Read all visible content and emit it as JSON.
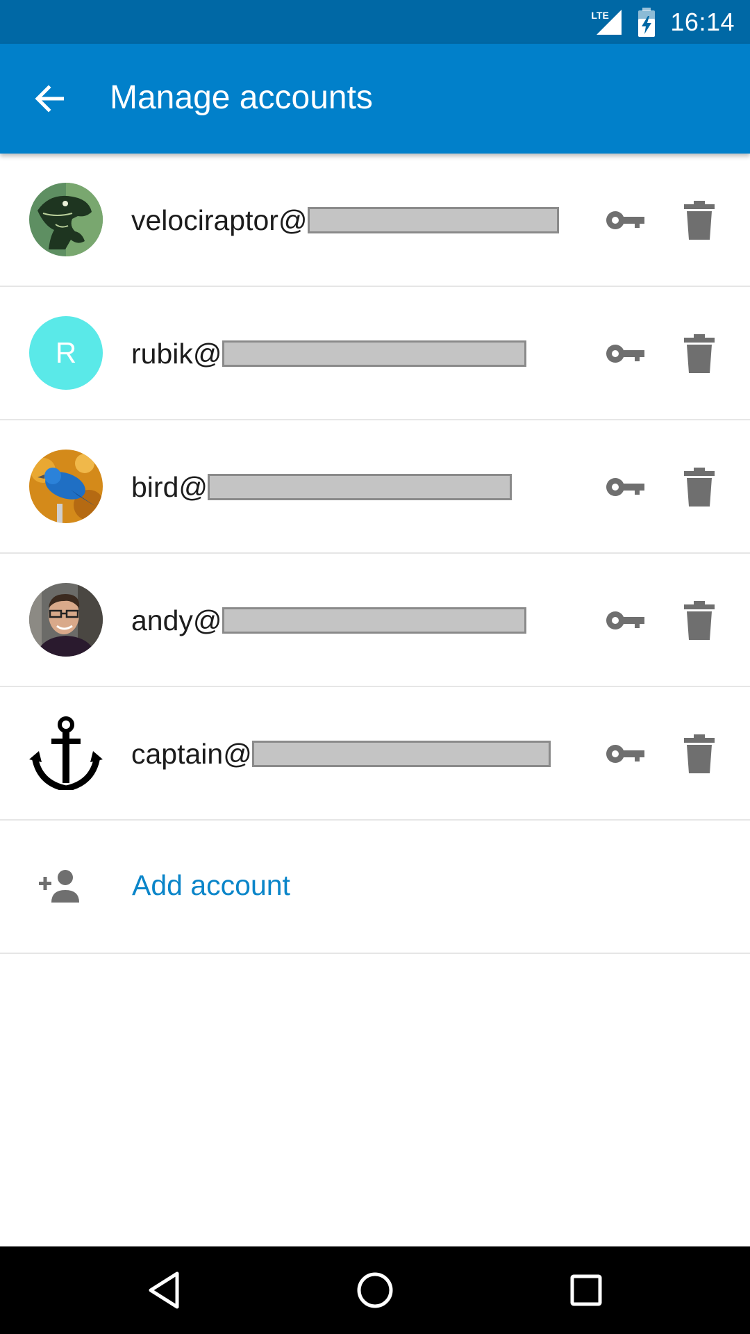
{
  "status_bar": {
    "network": "LTE",
    "time": "16:14"
  },
  "app_bar": {
    "title": "Manage accounts",
    "back_icon": "arrow-back-icon"
  },
  "accounts": [
    {
      "email_prefix": "velociraptor@",
      "avatar": "raptor-image"
    },
    {
      "email_prefix": "rubik@",
      "avatar_letter": "R",
      "avatar_color": "#5ae9e8"
    },
    {
      "email_prefix": "bird@",
      "avatar": "bird-image"
    },
    {
      "email_prefix": "andy@",
      "avatar": "person-photo"
    },
    {
      "email_prefix": "captain@",
      "avatar": "anchor-icon"
    }
  ],
  "row_icons": {
    "key": "key-icon",
    "delete": "trash-icon"
  },
  "add_account": {
    "label": "Add account",
    "icon": "person-add-icon"
  },
  "colors": {
    "status_bar": "#0068a5",
    "app_bar": "#0180ca",
    "link": "#0a85c9",
    "icon_gray": "#6f6f6f"
  }
}
